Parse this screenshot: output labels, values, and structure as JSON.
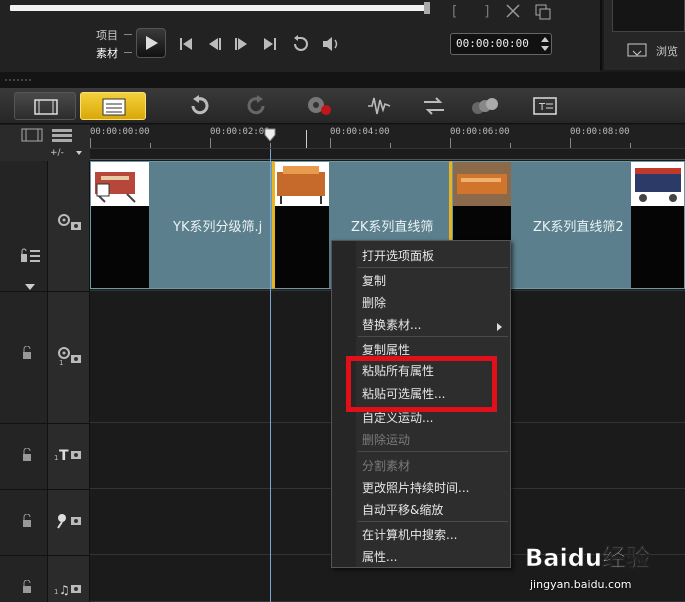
{
  "player": {
    "label_project": "项目",
    "label_clip": "素材",
    "timecode": "00:00:00:00",
    "browse_label": "浏览"
  },
  "ruler": {
    "ticks": [
      "00:00:00:00",
      "00:00:02:00",
      "00:00:04:00",
      "00:00:06:00",
      "00:00:08:00"
    ]
  },
  "timeline": {
    "clips": [
      {
        "title": "YK系列分级筛.j"
      },
      {
        "title": "ZK系列直线筛"
      },
      {
        "title": "ZK系列直线筛2"
      }
    ]
  },
  "context_menu": {
    "items": [
      "打开选项面板",
      "复制",
      "删除",
      "替换素材...",
      "复制属性",
      "粘贴所有属性",
      "粘贴可选属性...",
      "自定义运动...",
      "删除运动",
      "分割素材",
      "更改照片持续时间...",
      "自动平移&缩放",
      "在计算机中搜索...",
      "属性..."
    ]
  },
  "watermark": {
    "logo": "Baidu经验",
    "url": "jingyan.baidu.com"
  },
  "colors": {
    "timeline_button": "#e6b422",
    "clip_fill": "#5b7f8c",
    "highlight": "#e0101a",
    "playline": "#7aa6d6"
  }
}
